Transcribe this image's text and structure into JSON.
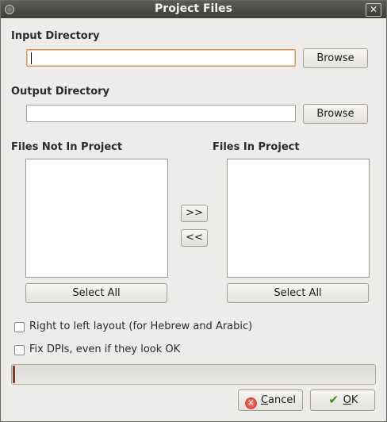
{
  "window": {
    "title": "Project Files",
    "close_symbol": "✕"
  },
  "input": {
    "label": "Input Directory",
    "value": "",
    "browse_label": "Browse"
  },
  "output": {
    "label": "Output Directory",
    "value": "",
    "browse_label": "Browse"
  },
  "lists": {
    "not_in_label": "Files Not In Project",
    "in_label": "Files In Project",
    "not_in_items": [],
    "in_items": [],
    "add_label": ">>",
    "remove_label": "<<",
    "select_all_left": "Select All",
    "select_all_right": "Select All"
  },
  "options": {
    "rtl_label": "Right to left layout (for Hebrew and Arabic)",
    "rtl_checked": false,
    "fixdpi_label": "Fix DPIs, even if they look OK",
    "fixdpi_checked": false
  },
  "progress": {
    "value": 0
  },
  "buttons": {
    "cancel_accel": "C",
    "cancel_rest": "ancel",
    "ok_accel": "O",
    "ok_rest": "K"
  },
  "icons": {
    "cancel": "cancel-icon",
    "ok": "ok-checkmark-icon",
    "window": "window-menu-icon"
  }
}
